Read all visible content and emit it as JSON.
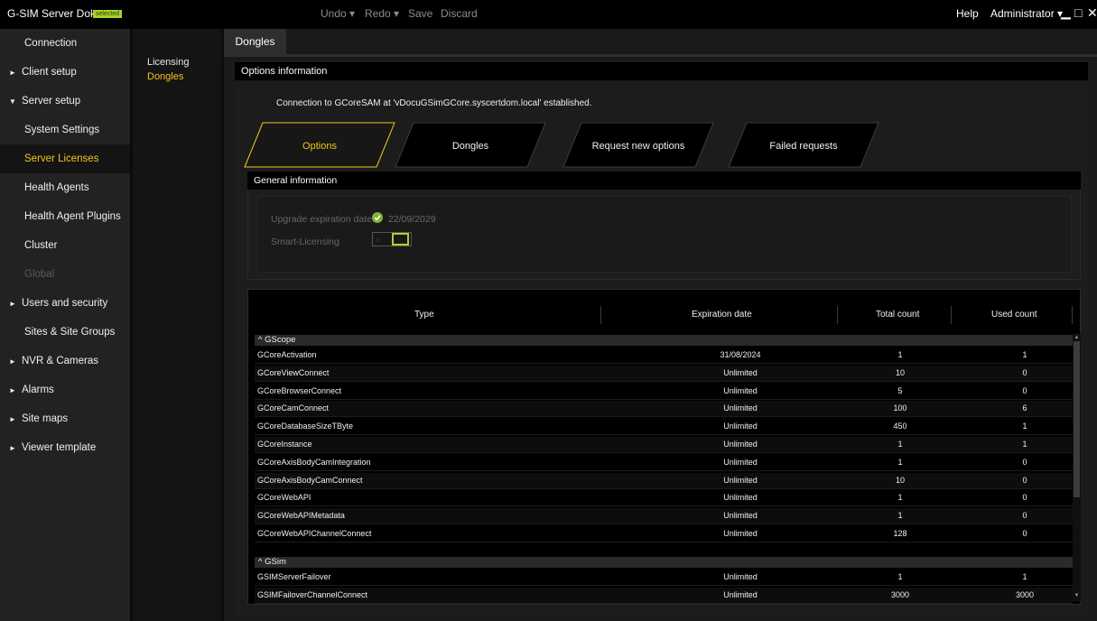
{
  "app": {
    "title": "G-SIM Server Doku",
    "badge": "selected"
  },
  "toolbar": {
    "undo": "Undo ▾",
    "redo": "Redo ▾",
    "save": "Save",
    "discard": "Discard"
  },
  "topright": {
    "help": "Help",
    "user": "Administrator ▾",
    "minimize": "▁",
    "maximize": "□",
    "close": "✕"
  },
  "sidebar": {
    "items": [
      {
        "label": "Connection",
        "group": false,
        "expanded": false,
        "active": false,
        "disabled": false
      },
      {
        "label": "Client setup",
        "group": true,
        "expanded": false,
        "active": false,
        "disabled": false
      },
      {
        "label": "Server setup",
        "group": true,
        "expanded": true,
        "active": false,
        "disabled": false
      },
      {
        "label": "System Settings",
        "group": false,
        "expanded": false,
        "active": false,
        "disabled": false
      },
      {
        "label": "Server Licenses",
        "group": false,
        "expanded": false,
        "active": true,
        "disabled": false
      },
      {
        "label": "Health Agents",
        "group": false,
        "expanded": false,
        "active": false,
        "disabled": false
      },
      {
        "label": "Health Agent Plugins",
        "group": false,
        "expanded": false,
        "active": false,
        "disabled": false
      },
      {
        "label": "Cluster",
        "group": false,
        "expanded": false,
        "active": false,
        "disabled": false
      },
      {
        "label": "Global",
        "group": false,
        "expanded": false,
        "active": false,
        "disabled": true
      },
      {
        "label": "Users and security",
        "group": true,
        "expanded": false,
        "active": false,
        "disabled": false
      },
      {
        "label": "Sites & Site Groups",
        "group": false,
        "expanded": false,
        "active": false,
        "disabled": false
      },
      {
        "label": "NVR & Cameras",
        "group": true,
        "expanded": false,
        "active": false,
        "disabled": false
      },
      {
        "label": "Alarms",
        "group": true,
        "expanded": false,
        "active": false,
        "disabled": false
      },
      {
        "label": "Site maps",
        "group": true,
        "expanded": false,
        "active": false,
        "disabled": false
      },
      {
        "label": "Viewer template",
        "group": true,
        "expanded": false,
        "active": false,
        "disabled": false
      }
    ]
  },
  "subnav": {
    "items": [
      {
        "label": "Licensing",
        "active": false
      },
      {
        "label": "Dongles",
        "active": true
      }
    ]
  },
  "main": {
    "tab": "Dongles",
    "section_title": "Options information",
    "connection_message": "Connection to GCoreSAM at 'vDocuGSimGCore.syscertdom.local' established.",
    "option_tabs": [
      {
        "label": "Options",
        "active": true
      },
      {
        "label": "Dongles",
        "active": false
      },
      {
        "label": "Request new options",
        "active": false
      },
      {
        "label": "Failed requests",
        "active": false
      }
    ],
    "general": {
      "title": "General information",
      "upgrade_label": "Upgrade expiration date:",
      "upgrade_value": "22/09/2029",
      "smart_label": "Smart-Licensing",
      "smart_off_glyph": "○",
      "smart_enabled": true
    },
    "table": {
      "columns": [
        "Type",
        "Expiration date",
        "Total count",
        "Used count"
      ],
      "groups": [
        {
          "name": "GScope",
          "rows": [
            {
              "type": "GCoreActivation",
              "expiration": "31/08/2024",
              "total": "1",
              "used": "1"
            },
            {
              "type": "GCoreViewConnect",
              "expiration": "Unlimited",
              "total": "10",
              "used": "0"
            },
            {
              "type": "GCoreBrowserConnect",
              "expiration": "Unlimited",
              "total": "5",
              "used": "0"
            },
            {
              "type": "GCoreCamConnect",
              "expiration": "Unlimited",
              "total": "100",
              "used": "6"
            },
            {
              "type": "GCoreDatabaseSizeTByte",
              "expiration": "Unlimited",
              "total": "450",
              "used": "1"
            },
            {
              "type": "GCoreInstance",
              "expiration": "Unlimited",
              "total": "1",
              "used": "1"
            },
            {
              "type": "GCoreAxisBodyCamIntegration",
              "expiration": "Unlimited",
              "total": "1",
              "used": "0"
            },
            {
              "type": "GCoreAxisBodyCamConnect",
              "expiration": "Unlimited",
              "total": "10",
              "used": "0"
            },
            {
              "type": "GCoreWebAPI",
              "expiration": "Unlimited",
              "total": "1",
              "used": "0"
            },
            {
              "type": "GCoreWebAPIMetadata",
              "expiration": "Unlimited",
              "total": "1",
              "used": "0"
            },
            {
              "type": "GCoreWebAPIChannelConnect",
              "expiration": "Unlimited",
              "total": "128",
              "used": "0"
            }
          ]
        },
        {
          "name": "GSim",
          "rows": [
            {
              "type": "GSIMServerFailover",
              "expiration": "Unlimited",
              "total": "1",
              "used": "1"
            },
            {
              "type": "GSIMFailoverChannelConnect",
              "expiration": "Unlimited",
              "total": "3000",
              "used": "3000"
            }
          ]
        }
      ]
    }
  },
  "colors": {
    "accent": "#f5c518",
    "badge": "#a5d22e",
    "check": "#7fb533",
    "toggle": "#a5d22e"
  },
  "icons": {
    "group_collapse": "chevron-up-icon",
    "nav_arrow": "caret-right-icon",
    "check": "check-circle-icon"
  }
}
